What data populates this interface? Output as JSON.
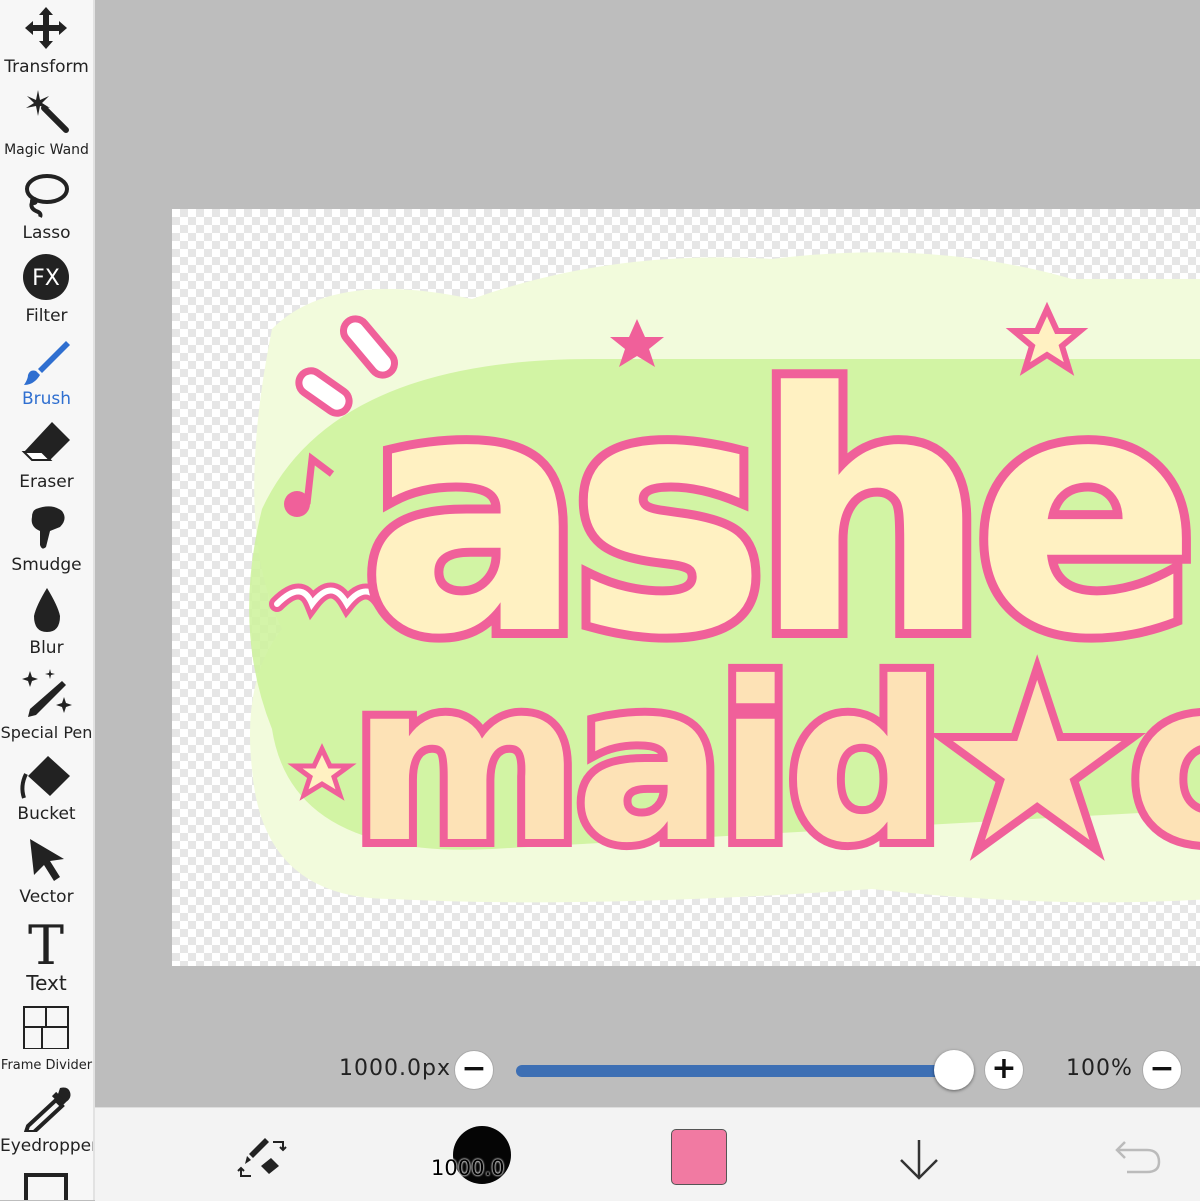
{
  "toolbar": {
    "tools": [
      {
        "label": "Transform",
        "icon": "move-arrows-icon"
      },
      {
        "label": "Magic Wand",
        "icon": "magic-wand-icon"
      },
      {
        "label": "Lasso",
        "icon": "lasso-icon"
      },
      {
        "label": "Filter",
        "icon": "fx-icon"
      },
      {
        "label": "Brush",
        "icon": "brush-icon",
        "active": true
      },
      {
        "label": "Eraser",
        "icon": "eraser-icon"
      },
      {
        "label": "Smudge",
        "icon": "smudge-icon"
      },
      {
        "label": "Blur",
        "icon": "drop-icon"
      },
      {
        "label": "Special Pen",
        "icon": "sparkle-pen-icon"
      },
      {
        "label": "Bucket",
        "icon": "bucket-icon"
      },
      {
        "label": "Vector",
        "icon": "arrow-cursor-icon"
      },
      {
        "label": "Text",
        "icon": "text-t-icon"
      },
      {
        "label": "Frame Divider",
        "icon": "frame-divider-icon"
      },
      {
        "label": "Eyedropper",
        "icon": "eyedropper-icon"
      }
    ],
    "active_color": "#2f6fd0",
    "fx_glyph": "FX",
    "text_glyph": "T"
  },
  "canvas": {
    "artwork_text_line1": "ashe",
    "artwork_text_line2": "maid★c",
    "colors": {
      "outline": "#f0609a",
      "fill": "#fff1c2",
      "halo": "#f2fbdc",
      "green": "#cdf29a"
    }
  },
  "brush_bar": {
    "size_value": "1000.0px",
    "minus_label": "−",
    "plus_label": "+",
    "size_slider_fraction": 1.0,
    "zoom_value": "100%",
    "zoom_minus_label": "−",
    "slider_color": "#3d6fb4"
  },
  "bottom_bar": {
    "brush_size_label": "1000.0",
    "current_color": "#f17aa2",
    "icons": [
      "swap-tools-icon",
      "brush-preview",
      "color-swatch",
      "down-arrow-icon",
      "undo-icon"
    ]
  }
}
